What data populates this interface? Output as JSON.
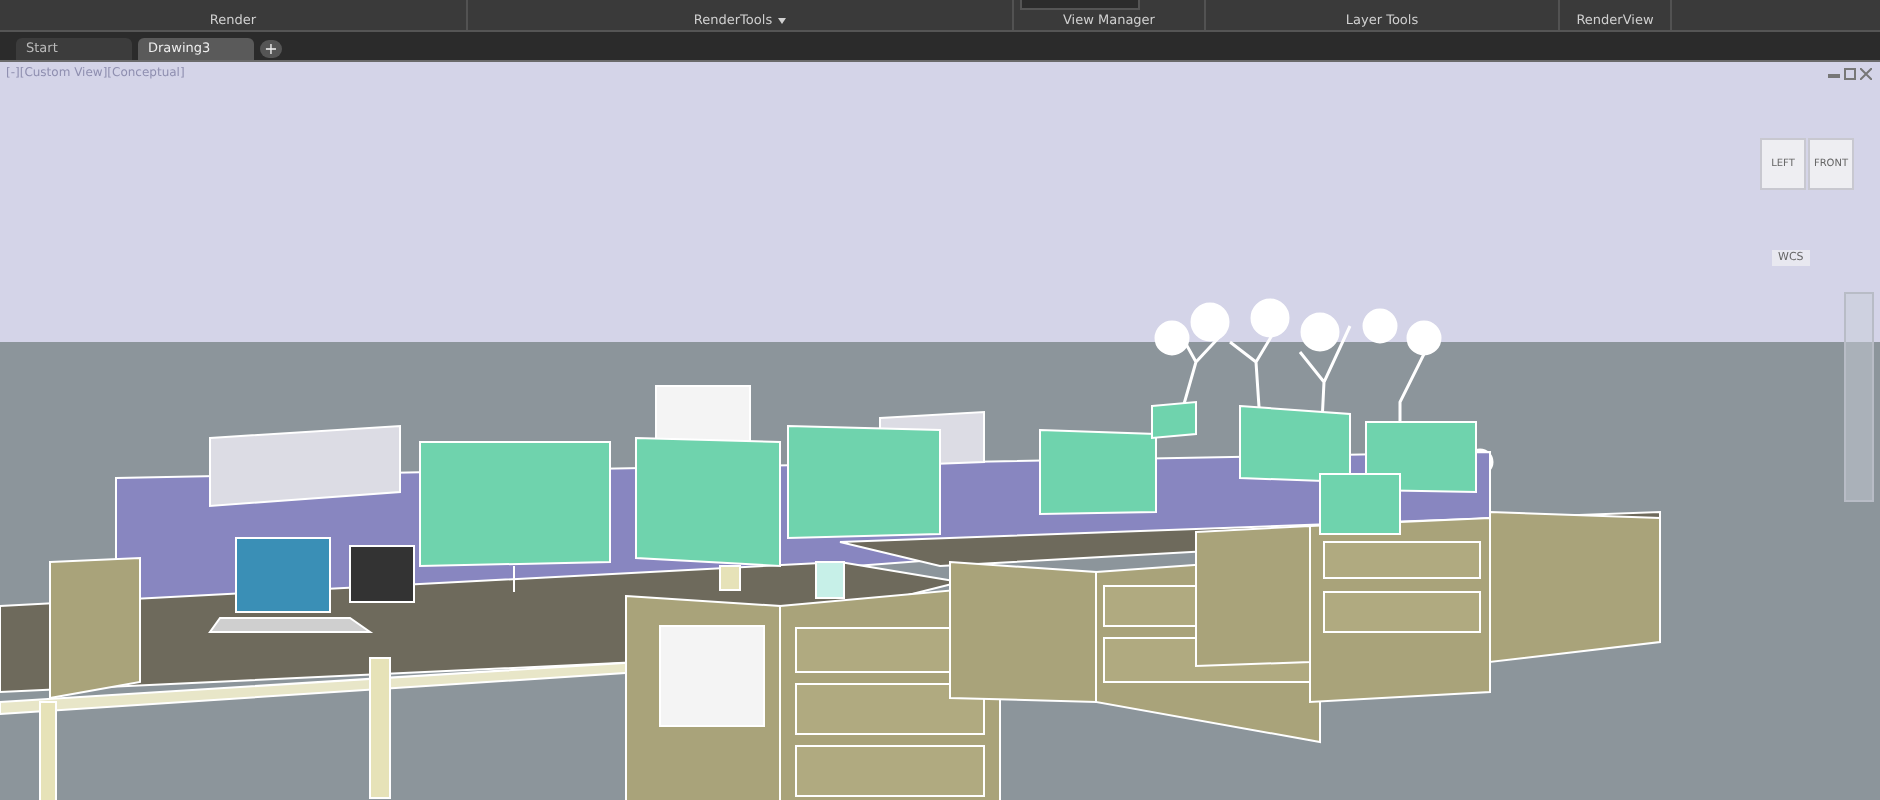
{
  "ribbon": {
    "panels": [
      {
        "label": "Render",
        "dropdown": false
      },
      {
        "label": "RenderTools",
        "dropdown": true
      },
      {
        "label": "View Manager",
        "dropdown": false
      },
      {
        "label": "Layer Tools",
        "dropdown": false
      },
      {
        "label": "RenderView",
        "dropdown": false
      }
    ]
  },
  "file_tabs": [
    {
      "label": "Start",
      "selected": false
    },
    {
      "label": "Drawing3",
      "selected": true
    }
  ],
  "new_tab_button": "+",
  "viewport": {
    "label": "[-][Custom View][Conceptual]",
    "viewcube_faces": [
      "LEFT",
      "FRONT"
    ],
    "ucs_menu": "WCS"
  }
}
